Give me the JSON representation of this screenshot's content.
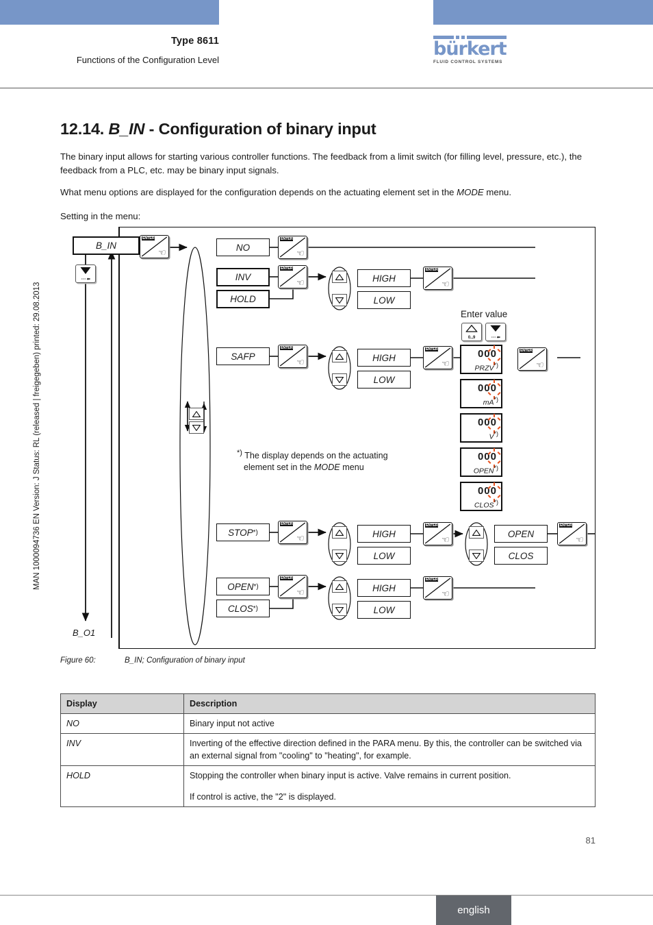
{
  "header": {
    "type_label": "Type 8611",
    "subtitle": "Functions of the Configuration Level",
    "logo_word": "bürkert",
    "logo_tagline": "FLUID CONTROL SYSTEMS"
  },
  "sidebar": {
    "doc_info": "MAN 1000094736  EN  Version: J  Status: RL (released | freigegeben)  printed: 29.08.2013"
  },
  "section": {
    "number": "12.14.",
    "name": "B_IN",
    "dash": "-",
    "title": "Configuration of binary input",
    "p1": "The binary input allows for starting various controller functions. The feedback from a limit switch (for filling level, pressure, etc.), the feedback from a PLC, etc. may be binary input signals.",
    "p2_a": "What menu options are displayed for the configuration depends on the actuating element set in the ",
    "p2_em": "MODE",
    "p2_b": " menu.",
    "p3": "Setting in the menu:"
  },
  "diagram": {
    "start_label": "B_IN",
    "end_label": "B_O1",
    "enter_key_label": "ENTER",
    "updown_range_label": "0...9",
    "enter_value_label": "Enter value",
    "footnote_marker": "*)",
    "footnote_line1": "The display depends on the actuating",
    "footnote_line2_a": "element set in the ",
    "footnote_line2_em": "MODE",
    "footnote_line2_b": " menu",
    "options": [
      {
        "label": "NO"
      },
      {
        "label": "INV"
      },
      {
        "label": "HOLD"
      },
      {
        "label": "SAFP"
      },
      {
        "label": "STOP",
        "marker": "*)"
      },
      {
        "label": "OPEN",
        "marker": "*)"
      },
      {
        "label": "CLOS",
        "marker": "*)"
      }
    ],
    "level_options": [
      {
        "high": "HIGH",
        "low": "LOW"
      },
      {
        "high": "HIGH",
        "low": "LOW"
      },
      {
        "high": "HIGH",
        "low": "LOW"
      },
      {
        "high": "HIGH",
        "low": "LOW"
      }
    ],
    "position_options": {
      "open": "OPEN",
      "clos": "CLOS"
    },
    "value_displays": [
      {
        "digits": "000",
        "unit": "PRZV",
        "marker": "*)"
      },
      {
        "digits": "000",
        "unit": "mA",
        "marker": "*)"
      },
      {
        "digits": "000",
        "unit": "V",
        "marker": "*)"
      },
      {
        "digits": "000",
        "unit": "OPEN",
        "marker": "*)"
      },
      {
        "digits": "000",
        "unit": "CLOS",
        "marker": "*)"
      }
    ]
  },
  "caption": {
    "tag": "Figure 60:",
    "text": "B_IN; Configuration of binary input"
  },
  "table": {
    "headers": [
      "Display",
      "Description"
    ],
    "rows": [
      {
        "display": "NO",
        "lines": [
          "Binary input not active"
        ]
      },
      {
        "display": "INV",
        "lines": [
          "Inverting of the effective direction defined in the PARA menu. By this, the controller can be switched via an external signal from \"cooling\" to \"heating\", for example."
        ]
      },
      {
        "display": "HOLD",
        "lines": [
          "Stopping the controller when binary input is active. Valve remains in current position.",
          "If control is active, the \"2\" is displayed."
        ]
      }
    ]
  },
  "footer": {
    "page_number": "81",
    "language": "english"
  },
  "colors": {
    "header_blue": "#7796c8",
    "footer_gray": "#62666c",
    "table_header": "#d4d4d4",
    "blink_orange": "#e8521f"
  }
}
